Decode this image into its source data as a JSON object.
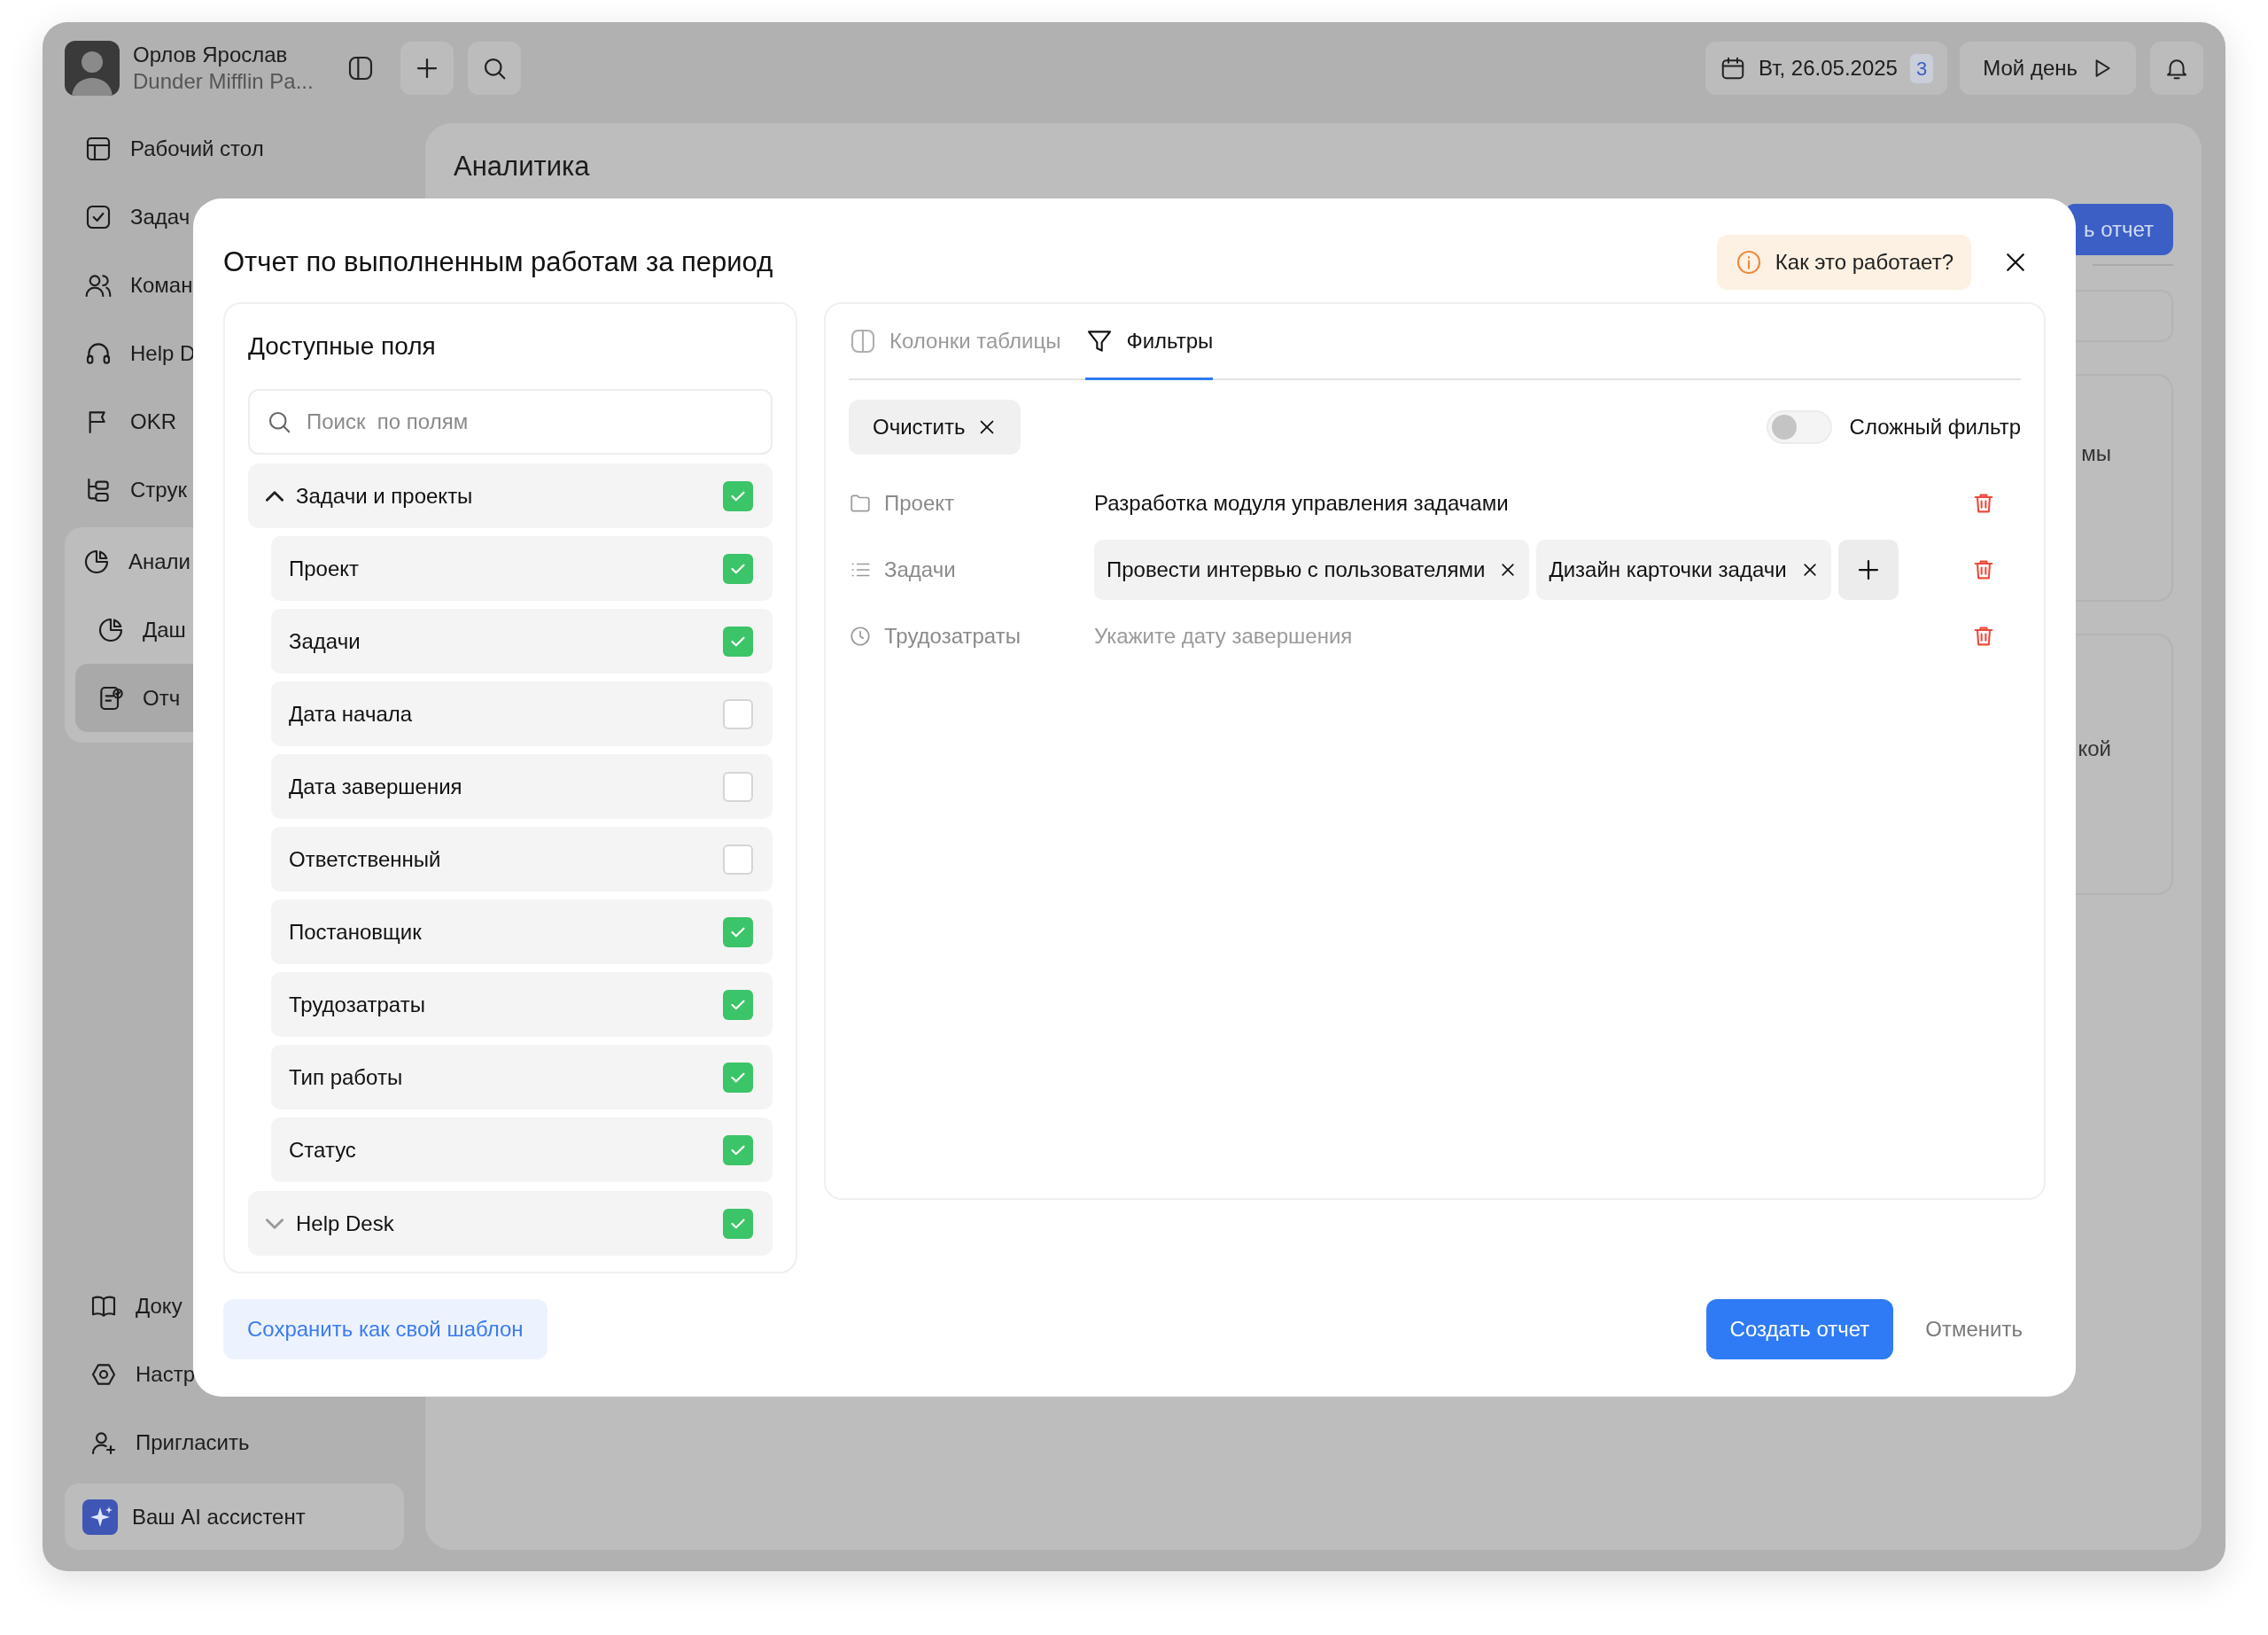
{
  "topbar": {
    "user_name": "Орлов Ярослав",
    "user_org": "Dunder Mifflin Pa...",
    "date": "Вт, 26.05.2025",
    "date_count": "3",
    "my_day": "Мой день"
  },
  "sidebar": {
    "items": [
      {
        "label": "Рабочий стол"
      },
      {
        "label": "Задач"
      },
      {
        "label": "Коман"
      },
      {
        "label": "Help D"
      },
      {
        "label": "OKR"
      },
      {
        "label": "Струк"
      },
      {
        "label": "Анали",
        "expanded": true,
        "children": [
          {
            "label": "Даш",
            "selected": false
          },
          {
            "label": "Отч",
            "selected": true
          }
        ]
      }
    ],
    "bottom_items": [
      {
        "label": "Доку"
      },
      {
        "label": "Настр"
      },
      {
        "label": "Пригласить"
      }
    ],
    "assistant": "Ваш AI ассистент"
  },
  "main": {
    "title": "Аналитика",
    "button": "ь отчет",
    "card_texts": [
      "мы",
      "кой"
    ]
  },
  "modal": {
    "title": "Отчет по выполненным работам за период",
    "help": "Как это работает?",
    "fields_panel": {
      "title": "Доступные поля",
      "search": {
        "placeholder": "Поиск  по полям"
      },
      "groups": [
        {
          "label": "Задачи и проекты",
          "expanded": true,
          "checked": true,
          "children": [
            {
              "label": "Проект",
              "checked": true
            },
            {
              "label": "Задачи",
              "checked": true
            },
            {
              "label": "Дата начала",
              "checked": false
            },
            {
              "label": "Дата завершения",
              "checked": false
            },
            {
              "label": "Ответственный",
              "checked": false
            },
            {
              "label": "Постановщик",
              "checked": true
            },
            {
              "label": "Трудозатраты",
              "checked": true
            },
            {
              "label": "Тип работы",
              "checked": true
            },
            {
              "label": "Статус",
              "checked": true
            }
          ]
        },
        {
          "label": "Help Desk",
          "expanded": false,
          "checked": true
        }
      ]
    },
    "tabs": [
      {
        "label": "Колонки таблицы",
        "selected": false
      },
      {
        "label": "Фильтры",
        "selected": true
      }
    ],
    "clear_button": "Очистить",
    "complex_filter": {
      "label": "Сложный фильтр",
      "on": false
    },
    "filters": [
      {
        "label": "Проект",
        "kind": "text",
        "value": "Разработка модуля управления задачами"
      },
      {
        "label": "Задачи",
        "kind": "chips",
        "chips": [
          "Провести интервью с пользователями",
          "Дизайн карточки задачи"
        ]
      },
      {
        "label": "Трудозатраты",
        "kind": "empty",
        "placeholder": "Укажите дату завершения"
      }
    ],
    "save_template": "Сохранить как свой шаблон",
    "create": "Создать отчет",
    "cancel": "Отменить"
  }
}
